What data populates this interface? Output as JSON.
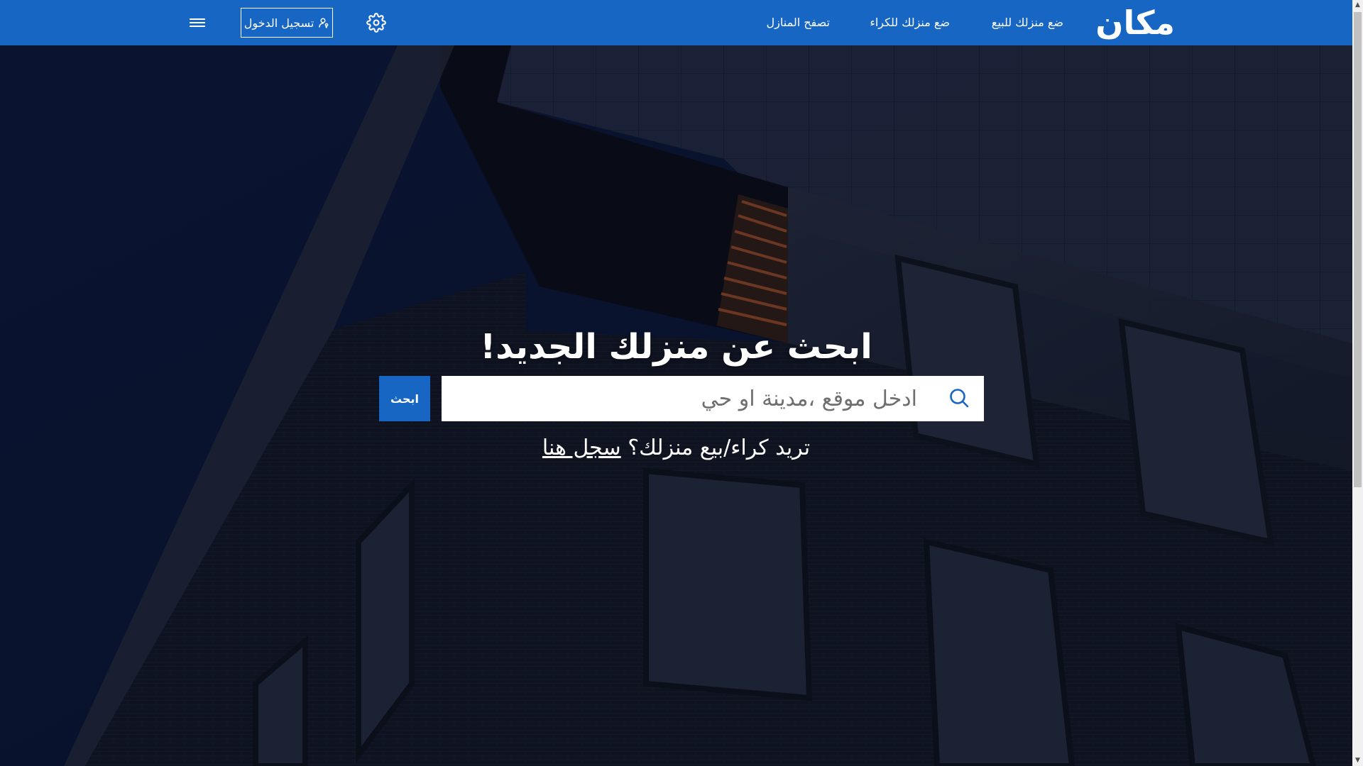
{
  "header": {
    "logo_text": "مكان",
    "nav": {
      "sell_label": "ضع منزلك للبيع",
      "rent_label": "ضع منزلك للكراء",
      "browse_label": "تصفح المنازل"
    },
    "login_label": "تسجيل الدخول",
    "icons": {
      "settings": "gear-icon",
      "login": "user-key-icon",
      "menu": "hamburger-menu-icon"
    }
  },
  "hero": {
    "title": "ابحث عن منزلك الجديد!",
    "search": {
      "placeholder": "ادخل موقع ،مدينة او حي",
      "button_label": "ابحث",
      "icon": "search-icon"
    },
    "register": {
      "prefix": "تريد كراء/بيع منزلك؟ ",
      "link_label": "سجل هنا"
    }
  },
  "colors": {
    "primary": "#1766c4",
    "text_on_primary": "#ffffff",
    "hero_overlay": "#0b1530"
  }
}
